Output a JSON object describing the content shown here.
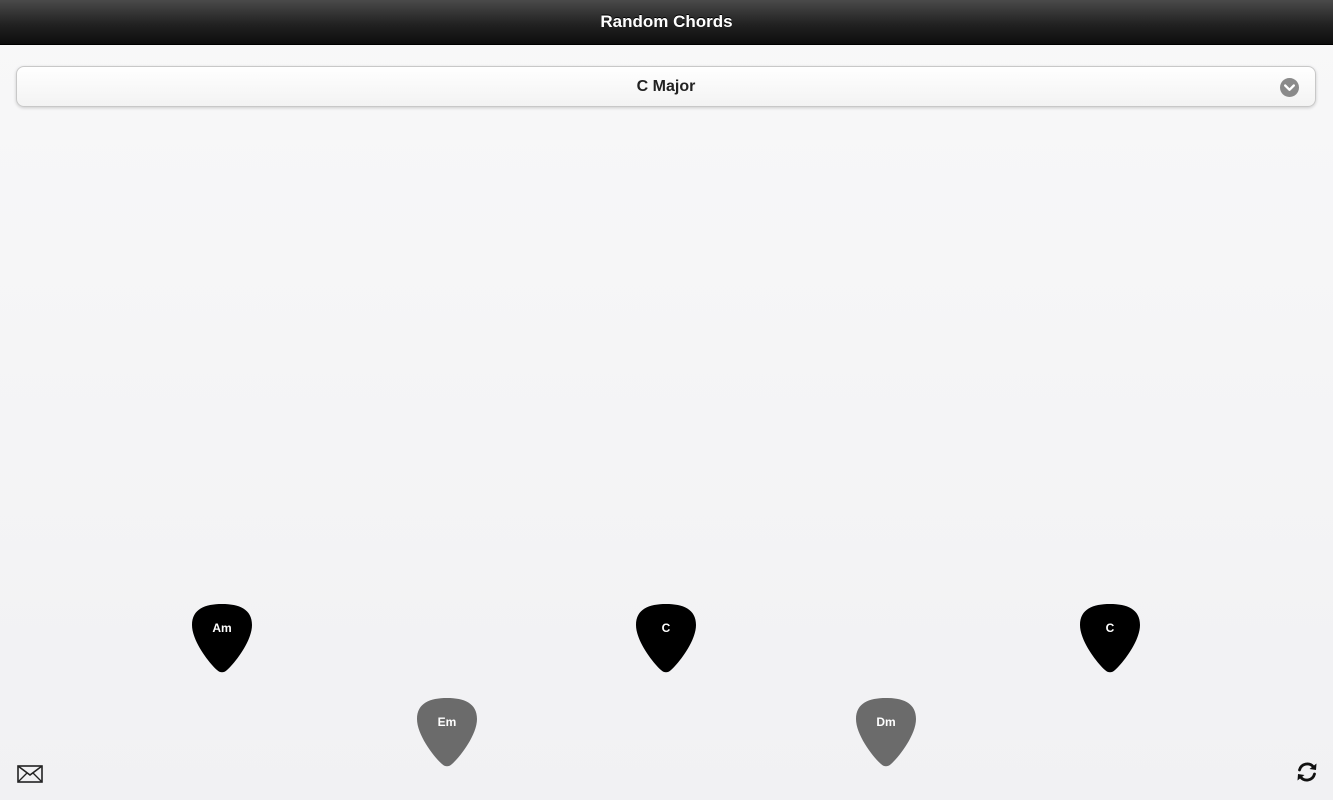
{
  "header": {
    "title": "Random Chords"
  },
  "key_select": {
    "value": "C Major"
  },
  "chords": [
    {
      "label": "Am",
      "row": "top",
      "color": "#000000"
    },
    {
      "label": "Em",
      "row": "bottom",
      "color": "#6b6b6b"
    },
    {
      "label": "C",
      "row": "top",
      "color": "#000000"
    },
    {
      "label": "Dm",
      "row": "bottom",
      "color": "#6b6b6b"
    },
    {
      "label": "C",
      "row": "top",
      "color": "#000000"
    }
  ],
  "footer": {
    "left_icon": "mail-icon",
    "right_icon": "refresh-icon"
  }
}
